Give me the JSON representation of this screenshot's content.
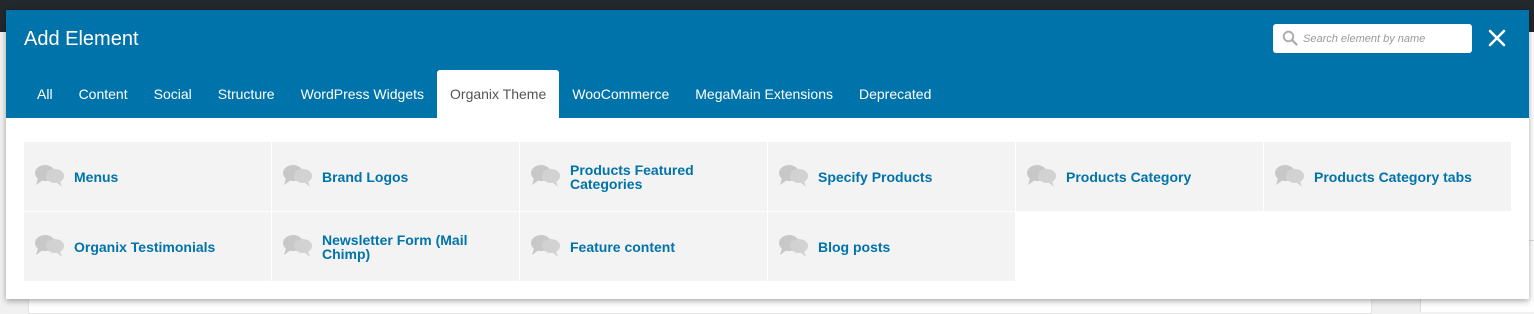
{
  "modal": {
    "title": "Add Element",
    "search": {
      "placeholder": "Search element by name",
      "value": ""
    }
  },
  "tabs": [
    {
      "label": "All"
    },
    {
      "label": "Content"
    },
    {
      "label": "Social"
    },
    {
      "label": "Structure"
    },
    {
      "label": "WordPress Widgets"
    },
    {
      "label": "Organix Theme",
      "active": true
    },
    {
      "label": "WooCommerce"
    },
    {
      "label": "MegaMain Extensions"
    },
    {
      "label": "Deprecated"
    }
  ],
  "elements": [
    {
      "label": "Menus",
      "icon": "chat-bubbles-icon"
    },
    {
      "label": "Brand Logos",
      "icon": "chat-bubbles-icon"
    },
    {
      "label": "Products Featured Categories",
      "icon": "chat-bubbles-icon"
    },
    {
      "label": "Specify Products",
      "icon": "chat-bubbles-icon"
    },
    {
      "label": "Products Category",
      "icon": "chat-bubbles-icon"
    },
    {
      "label": "Products Category tabs",
      "icon": "chat-bubbles-icon"
    },
    {
      "label": "Organix Testimonials",
      "icon": "chat-bubbles-icon"
    },
    {
      "label": "Newsletter Form (Mail Chimp)",
      "icon": "chat-bubbles-icon"
    },
    {
      "label": "Feature content",
      "icon": "chat-bubbles-icon"
    },
    {
      "label": "Blog posts",
      "icon": "chat-bubbles-icon"
    }
  ],
  "colors": {
    "header": "#0073aa",
    "item_bg": "#f3f3f3",
    "item_text": "#0073aa",
    "icon": "#c8c8c8"
  }
}
